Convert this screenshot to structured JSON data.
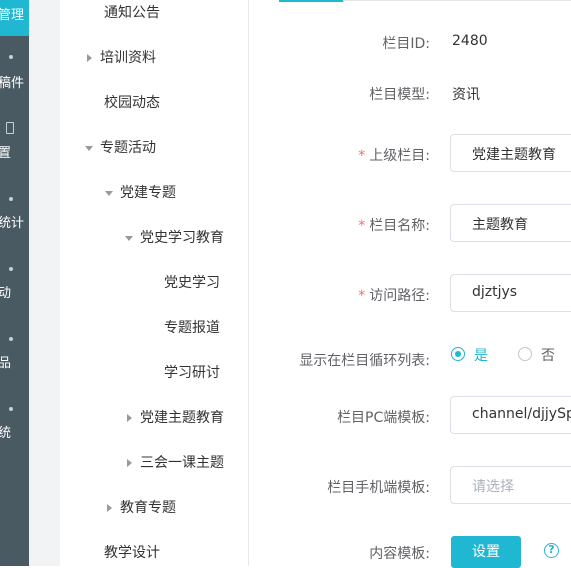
{
  "rail": {
    "active_label": "管理",
    "items": [
      "稿件",
      "置",
      "统计",
      "动",
      "品",
      "统"
    ]
  },
  "tree": {
    "items": [
      {
        "label": "通知公告"
      },
      {
        "label": "培训资料"
      },
      {
        "label": "校园动态"
      },
      {
        "label": "专题活动"
      },
      {
        "label": "党建专题"
      },
      {
        "label": "党史学习教育"
      },
      {
        "label": "党史学习"
      },
      {
        "label": "专题报道"
      },
      {
        "label": "学习研讨"
      },
      {
        "label": "党建主题教育"
      },
      {
        "label": "三会一课主题"
      },
      {
        "label": "教育专题"
      },
      {
        "label": "教学设计"
      }
    ]
  },
  "form": {
    "id_label": "栏目ID:",
    "id_value": "2480",
    "model_label": "栏目模型:",
    "model_value": "资讯",
    "parent_label": "上级栏目:",
    "parent_value": "党建主题教育",
    "name_label": "栏目名称:",
    "name_value": "主题教育",
    "path_label": "访问路径:",
    "path_value": "djztjys",
    "show_label": "显示在栏目循环列表:",
    "show_yes": "是",
    "show_no": "否",
    "show_selected": "是",
    "pc_label": "栏目PC端模板:",
    "pc_value": "channel/djjySpe",
    "mobile_label": "栏目手机端模板:",
    "mobile_placeholder": "请选择",
    "content_label": "内容模板:",
    "content_button": "设置",
    "help": "?"
  },
  "colors": {
    "accent": "#1fb7d2",
    "rail": "#4a5a63",
    "required": "#f56c6c"
  }
}
